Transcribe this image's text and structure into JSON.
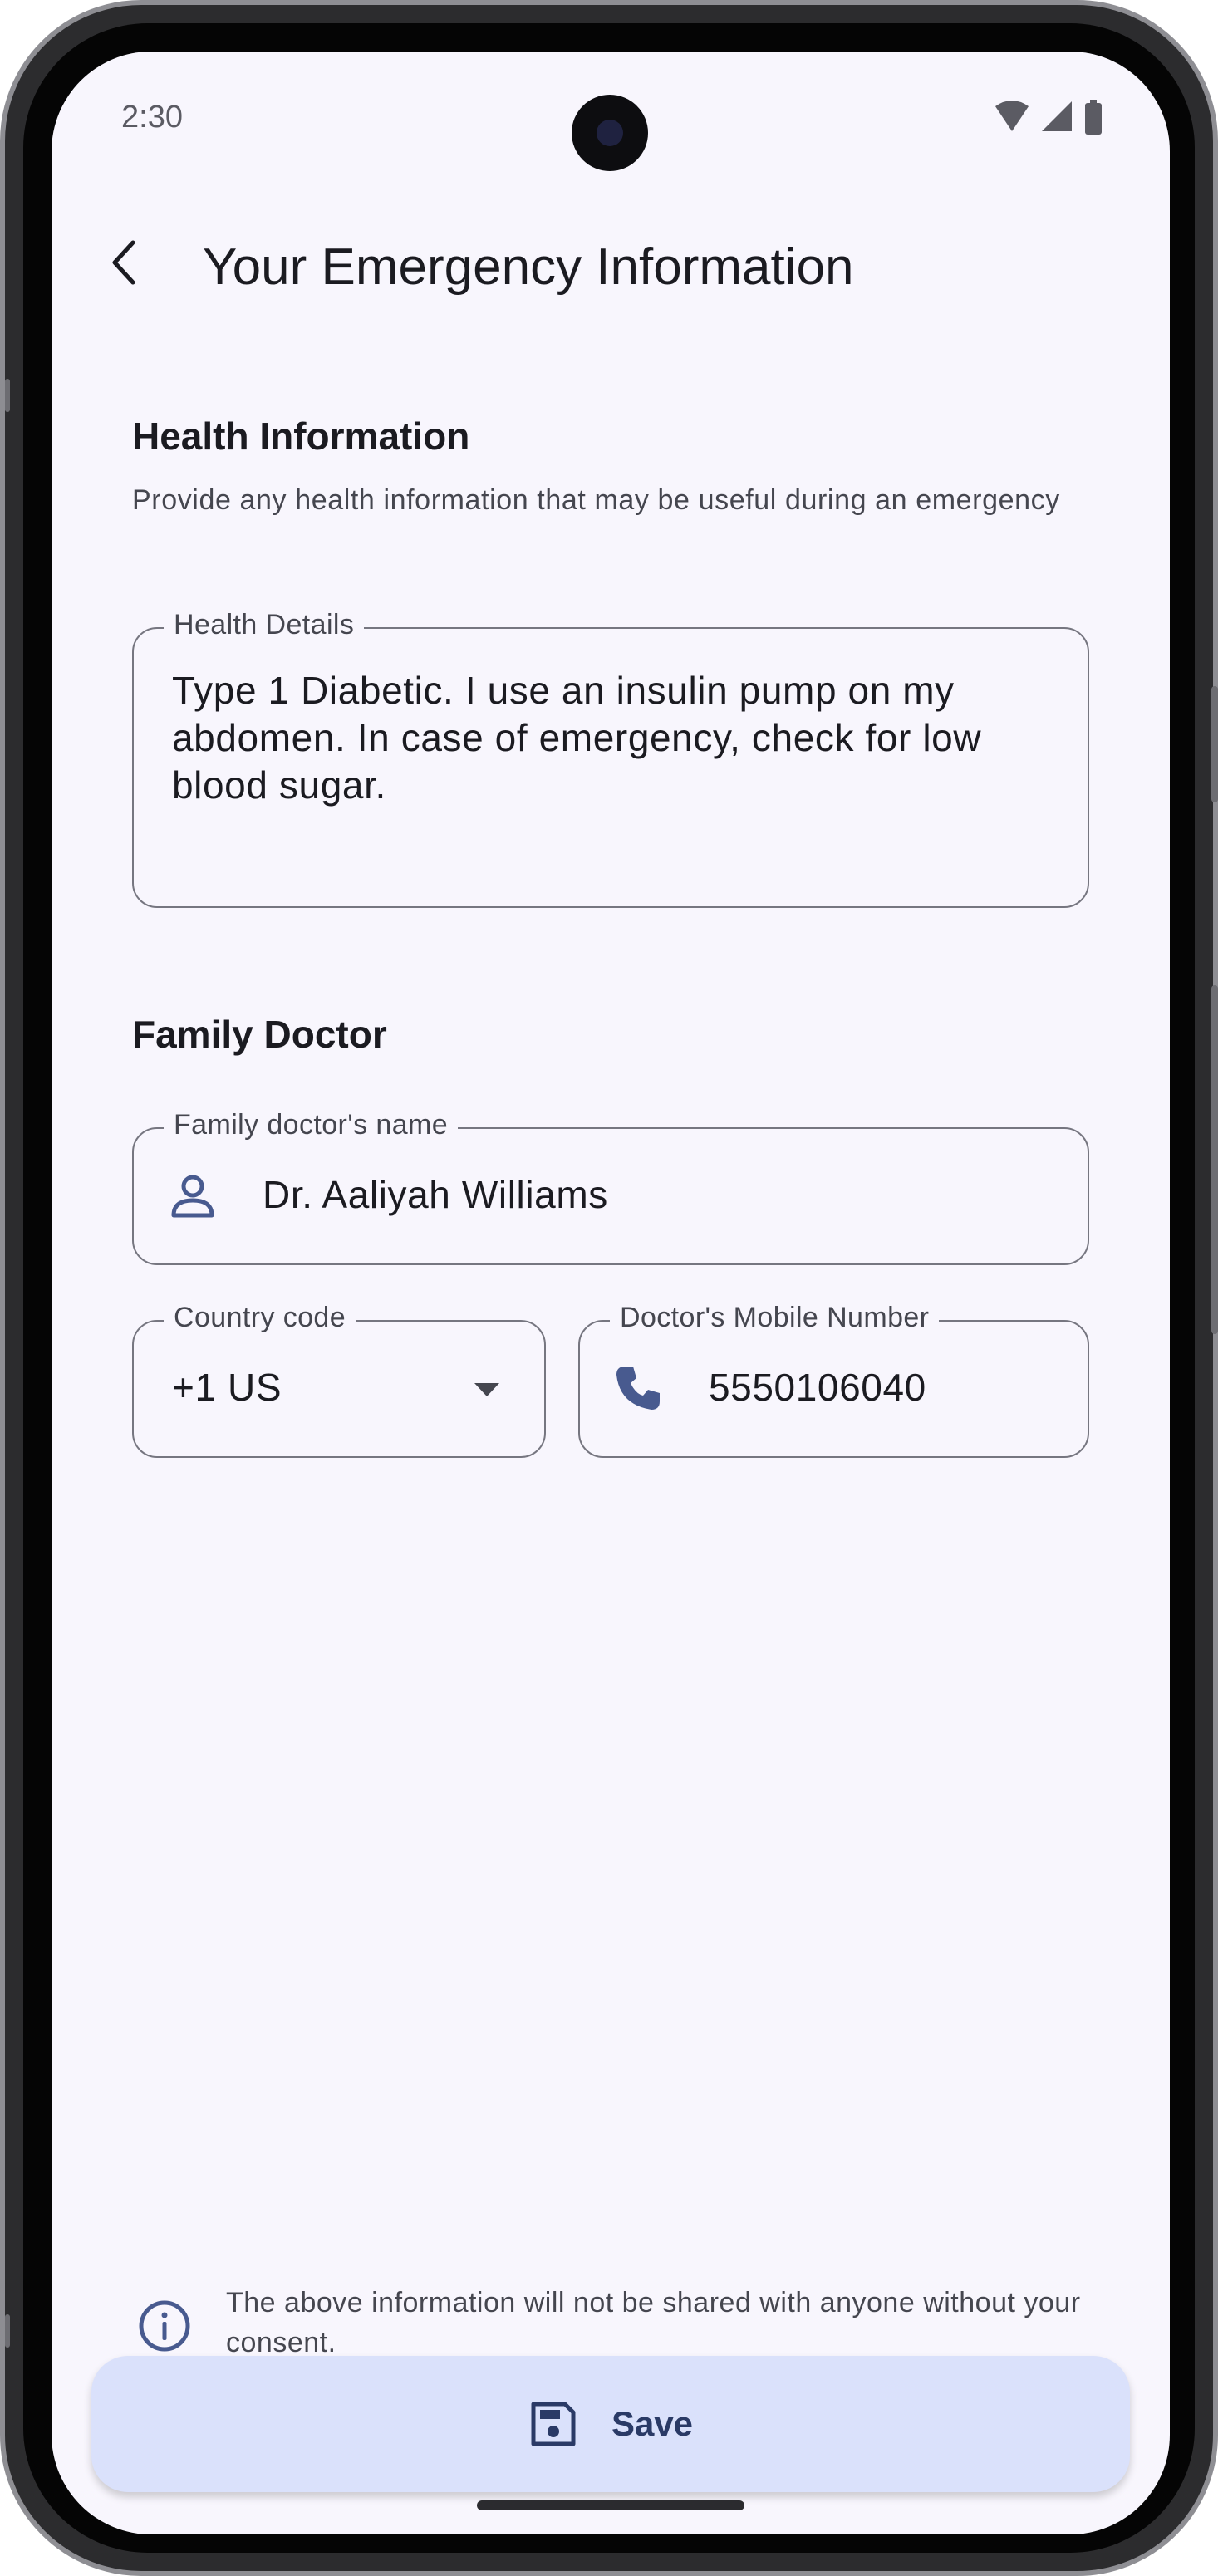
{
  "status_bar": {
    "time": "2:30"
  },
  "header": {
    "title": "Your Emergency Information"
  },
  "health": {
    "section_title": "Health Information",
    "description": "Provide any health information that may be useful during an emergency",
    "field_label": "Health Details",
    "field_value": "Type 1 Diabetic. I use an insulin pump on my abdomen. In case of emergency, check for low blood sugar."
  },
  "doctor": {
    "section_title": "Family Doctor",
    "name_label": "Family doctor's name",
    "name_value": "Dr. Aaliyah Williams",
    "country_label": "Country code",
    "country_value": "+1 US",
    "phone_label": "Doctor's Mobile Number",
    "phone_value": "5550106040"
  },
  "footer": {
    "info_text": "The above information will not be shared with anyone without your consent.",
    "save_label": "Save"
  },
  "icons": {
    "back": "arrow-back-icon",
    "person": "person-icon",
    "dropdown": "dropdown-arrow-icon",
    "phone": "phone-icon",
    "info": "info-icon",
    "save": "save-icon"
  },
  "colors": {
    "accent": "#485a8f",
    "save_button_bg": "#dae1fb",
    "screen_bg": "#f8f6fd"
  }
}
